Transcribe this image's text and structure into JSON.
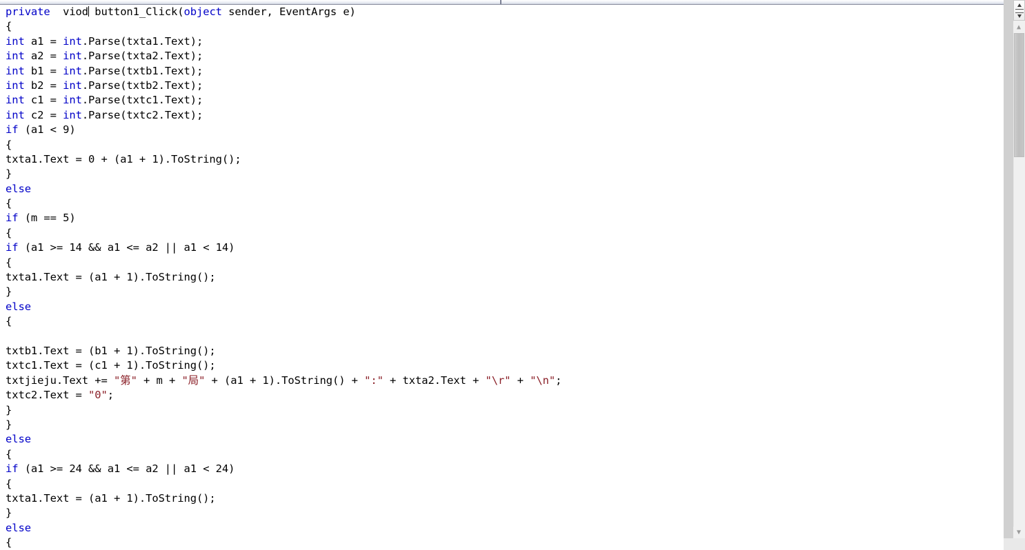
{
  "window": {
    "kind": "code-editor",
    "language": "C#"
  },
  "top_strip": {
    "divider_present": true
  },
  "colors": {
    "background": "#ffffff",
    "text": "#000000",
    "keyword": "#0000c8",
    "string": "#8b2028",
    "scrollbar_track": "#f0f0f0",
    "scrollbar_thumb": "#c3c3c3",
    "gutter": "#d0d0d0"
  },
  "scrollbar": {
    "up_arrow": "chevron-up-icon",
    "down_arrow": "chevron-down-icon",
    "split_handle": "split-pane-handle"
  },
  "editor": {
    "caret_line": 1,
    "caret_after_text": "viod",
    "lines": [
      {
        "n": 1,
        "tokens": [
          {
            "t": "kw",
            "v": "private"
          },
          {
            "t": "pun",
            "v": "  "
          },
          {
            "t": "pun",
            "v": "viod"
          },
          {
            "t": "caret",
            "v": ""
          },
          {
            "t": "pun",
            "v": " button1_Click("
          },
          {
            "t": "kw",
            "v": "object"
          },
          {
            "t": "pun",
            "v": " sender, EventArgs e)"
          }
        ]
      },
      {
        "n": 2,
        "tokens": [
          {
            "t": "pun",
            "v": "{"
          }
        ]
      },
      {
        "n": 3,
        "tokens": [
          {
            "t": "kw",
            "v": "int"
          },
          {
            "t": "pun",
            "v": " a1 = "
          },
          {
            "t": "kw",
            "v": "int"
          },
          {
            "t": "pun",
            "v": ".Parse(txta1.Text);"
          }
        ]
      },
      {
        "n": 4,
        "tokens": [
          {
            "t": "kw",
            "v": "int"
          },
          {
            "t": "pun",
            "v": " a2 = "
          },
          {
            "t": "kw",
            "v": "int"
          },
          {
            "t": "pun",
            "v": ".Parse(txta2.Text);"
          }
        ]
      },
      {
        "n": 5,
        "tokens": [
          {
            "t": "kw",
            "v": "int"
          },
          {
            "t": "pun",
            "v": " b1 = "
          },
          {
            "t": "kw",
            "v": "int"
          },
          {
            "t": "pun",
            "v": ".Parse(txtb1.Text);"
          }
        ]
      },
      {
        "n": 6,
        "tokens": [
          {
            "t": "kw",
            "v": "int"
          },
          {
            "t": "pun",
            "v": " b2 = "
          },
          {
            "t": "kw",
            "v": "int"
          },
          {
            "t": "pun",
            "v": ".Parse(txtb2.Text);"
          }
        ]
      },
      {
        "n": 7,
        "tokens": [
          {
            "t": "kw",
            "v": "int"
          },
          {
            "t": "pun",
            "v": " c1 = "
          },
          {
            "t": "kw",
            "v": "int"
          },
          {
            "t": "pun",
            "v": ".Parse(txtc1.Text);"
          }
        ]
      },
      {
        "n": 8,
        "tokens": [
          {
            "t": "kw",
            "v": "int"
          },
          {
            "t": "pun",
            "v": " c2 = "
          },
          {
            "t": "kw",
            "v": "int"
          },
          {
            "t": "pun",
            "v": ".Parse(txtc2.Text);"
          }
        ]
      },
      {
        "n": 9,
        "tokens": [
          {
            "t": "kw",
            "v": "if"
          },
          {
            "t": "pun",
            "v": " (a1 < 9)"
          }
        ]
      },
      {
        "n": 10,
        "tokens": [
          {
            "t": "pun",
            "v": "{"
          }
        ]
      },
      {
        "n": 11,
        "tokens": [
          {
            "t": "pun",
            "v": "txta1.Text = 0 + (a1 + 1).ToString();"
          }
        ]
      },
      {
        "n": 12,
        "tokens": [
          {
            "t": "pun",
            "v": "}"
          }
        ]
      },
      {
        "n": 13,
        "tokens": [
          {
            "t": "kw",
            "v": "else"
          }
        ]
      },
      {
        "n": 14,
        "tokens": [
          {
            "t": "pun",
            "v": "{"
          }
        ]
      },
      {
        "n": 15,
        "tokens": [
          {
            "t": "kw",
            "v": "if"
          },
          {
            "t": "pun",
            "v": " (m == 5)"
          }
        ]
      },
      {
        "n": 16,
        "tokens": [
          {
            "t": "pun",
            "v": "{"
          }
        ]
      },
      {
        "n": 17,
        "tokens": [
          {
            "t": "kw",
            "v": "if"
          },
          {
            "t": "pun",
            "v": " (a1 >= 14 && a1 <= a2 || a1 < 14)"
          }
        ]
      },
      {
        "n": 18,
        "tokens": [
          {
            "t": "pun",
            "v": "{"
          }
        ]
      },
      {
        "n": 19,
        "tokens": [
          {
            "t": "pun",
            "v": "txta1.Text = (a1 + 1).ToString();"
          }
        ]
      },
      {
        "n": 20,
        "tokens": [
          {
            "t": "pun",
            "v": "}"
          }
        ]
      },
      {
        "n": 21,
        "tokens": [
          {
            "t": "kw",
            "v": "else"
          }
        ]
      },
      {
        "n": 22,
        "tokens": [
          {
            "t": "pun",
            "v": "{"
          }
        ]
      },
      {
        "n": 23,
        "tokens": []
      },
      {
        "n": 24,
        "tokens": [
          {
            "t": "pun",
            "v": "txtb1.Text = (b1 + 1).ToString();"
          }
        ]
      },
      {
        "n": 25,
        "tokens": [
          {
            "t": "pun",
            "v": "txtc1.Text = (c1 + 1).ToString();"
          }
        ]
      },
      {
        "n": 26,
        "tokens": [
          {
            "t": "pun",
            "v": "txtjieju.Text += "
          },
          {
            "t": "str",
            "v": "\"第\""
          },
          {
            "t": "pun",
            "v": " + m + "
          },
          {
            "t": "str",
            "v": "\"局\""
          },
          {
            "t": "pun",
            "v": " + (a1 + 1).ToString() + "
          },
          {
            "t": "str",
            "v": "\":\""
          },
          {
            "t": "pun",
            "v": " + txta2.Text + "
          },
          {
            "t": "str",
            "v": "\"\\r\""
          },
          {
            "t": "pun",
            "v": " + "
          },
          {
            "t": "str",
            "v": "\"\\n\""
          },
          {
            "t": "pun",
            "v": ";"
          }
        ]
      },
      {
        "n": 27,
        "tokens": [
          {
            "t": "pun",
            "v": "txtc2.Text = "
          },
          {
            "t": "str",
            "v": "\"0\""
          },
          {
            "t": "pun",
            "v": ";"
          }
        ]
      },
      {
        "n": 28,
        "tokens": [
          {
            "t": "pun",
            "v": "}"
          }
        ]
      },
      {
        "n": 29,
        "tokens": [
          {
            "t": "pun",
            "v": "}"
          }
        ]
      },
      {
        "n": 30,
        "tokens": [
          {
            "t": "kw",
            "v": "else"
          }
        ]
      },
      {
        "n": 31,
        "tokens": [
          {
            "t": "pun",
            "v": "{"
          }
        ]
      },
      {
        "n": 32,
        "tokens": [
          {
            "t": "kw",
            "v": "if"
          },
          {
            "t": "pun",
            "v": " (a1 >= 24 && a1 <= a2 || a1 < 24)"
          }
        ]
      },
      {
        "n": 33,
        "tokens": [
          {
            "t": "pun",
            "v": "{"
          }
        ]
      },
      {
        "n": 34,
        "tokens": [
          {
            "t": "pun",
            "v": "txta1.Text = (a1 + 1).ToString();"
          }
        ]
      },
      {
        "n": 35,
        "tokens": [
          {
            "t": "pun",
            "v": "}"
          }
        ]
      },
      {
        "n": 36,
        "tokens": [
          {
            "t": "kw",
            "v": "else"
          }
        ]
      },
      {
        "n": 37,
        "tokens": [
          {
            "t": "pun",
            "v": "{"
          }
        ]
      }
    ]
  }
}
